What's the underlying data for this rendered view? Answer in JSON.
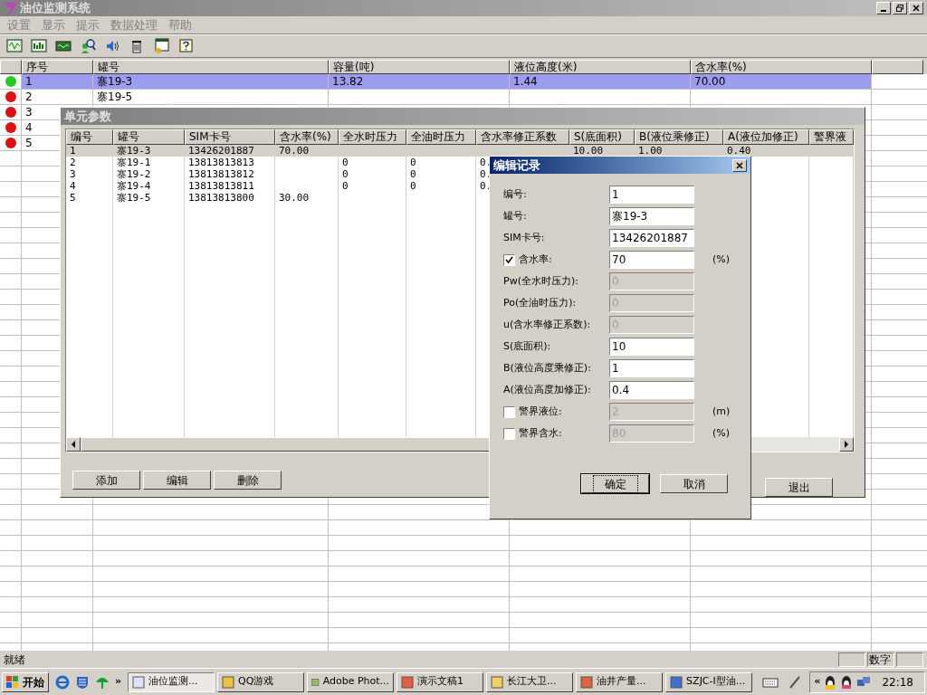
{
  "window": {
    "title": "油位监测系统"
  },
  "menu": [
    "设置",
    "显示",
    "提示",
    "数据处理",
    "帮助"
  ],
  "main_table": {
    "columns": [
      "序号",
      "罐号",
      "容量(吨)",
      "液位高度(米)",
      "含水率(%)"
    ],
    "rows": [
      {
        "color": "#22cc22",
        "selected": true,
        "cells": [
          "1",
          "寨19-3",
          "13.82",
          "1.44",
          "70.00"
        ]
      },
      {
        "color": "#dd1111",
        "selected": false,
        "cells": [
          "2",
          "寨19-5"
        ]
      },
      {
        "color": "#dd1111",
        "selected": false,
        "cells": [
          "3"
        ]
      },
      {
        "color": "#dd1111",
        "selected": false,
        "cells": [
          "4"
        ]
      },
      {
        "color": "#dd1111",
        "selected": false,
        "cells": [
          "5"
        ]
      }
    ]
  },
  "units_dialog": {
    "title": "单元参数",
    "columns": [
      "编号",
      "罐号",
      "SIM卡号",
      "含水率(%)",
      "全水时压力",
      "全油时压力",
      "含水率修正系数",
      "S(底面积)",
      "B(液位乘修正)",
      "A(液位加修正)",
      "警界液"
    ],
    "rows": [
      {
        "selected": true,
        "cells": [
          "1",
          "寨19-3",
          "13426201887",
          "70.00",
          null,
          null,
          null,
          "10.00",
          "1.00",
          "0.40"
        ]
      },
      {
        "selected": false,
        "cells": [
          "2",
          "寨19-1",
          "13813813813",
          null,
          "0",
          "0",
          "0."
        ]
      },
      {
        "selected": false,
        "cells": [
          "3",
          "寨19-2",
          "13813813812",
          null,
          "0",
          "0",
          "0."
        ]
      },
      {
        "selected": false,
        "cells": [
          "4",
          "寨19-4",
          "13813813811",
          null,
          "0",
          "0",
          "0."
        ]
      },
      {
        "selected": false,
        "cells": [
          "5",
          "寨19-5",
          "13813813800",
          "30.00"
        ]
      }
    ],
    "buttons": [
      "添加",
      "编辑",
      "删除"
    ],
    "exit_button": "退出"
  },
  "edit_dialog": {
    "title": "编辑记录",
    "fields": [
      {
        "kind": "text",
        "label": "编号:",
        "value": "1",
        "disabled": false
      },
      {
        "kind": "text",
        "label": "罐号:",
        "value": "寨19-3",
        "disabled": false
      },
      {
        "kind": "text",
        "label": "SIM卡号:",
        "value": "13426201887",
        "disabled": false
      },
      {
        "kind": "check",
        "label": "含水率:",
        "checked": true,
        "value": "70",
        "disabled": false,
        "unit": "(%)"
      },
      {
        "kind": "text",
        "label": "Pw(全水时压力):",
        "value": "0",
        "disabled": true
      },
      {
        "kind": "text",
        "label": "Po(全油时压力):",
        "value": "0",
        "disabled": true
      },
      {
        "kind": "text",
        "label": "u(含水率修正系数):",
        "value": "0",
        "disabled": true
      },
      {
        "kind": "text",
        "label": "S(底面积):",
        "value": "10",
        "disabled": false
      },
      {
        "kind": "text",
        "label": "B(液位高度乘修正):",
        "value": "1",
        "disabled": false
      },
      {
        "kind": "text",
        "label": "A(液位高度加修正):",
        "value": "0.4",
        "disabled": false
      },
      {
        "kind": "check",
        "label": "警界液位:",
        "checked": false,
        "value": "2",
        "disabled": true,
        "unit": "(m)"
      },
      {
        "kind": "check",
        "label": "警界含水:",
        "checked": false,
        "value": "80",
        "disabled": true,
        "unit": "(%)"
      }
    ],
    "buttons": [
      {
        "label": "确定",
        "default": true
      },
      {
        "label": "取消",
        "default": false
      }
    ]
  },
  "status_bar": {
    "text": "就绪",
    "indicator": "数字"
  },
  "taskbar": {
    "start": "开始",
    "more": "»",
    "tasks": [
      {
        "label": "油位监测...",
        "selected": true
      },
      {
        "label": "QQ游戏",
        "selected": false
      },
      {
        "label": "Adobe Phot...",
        "selected": false
      },
      {
        "label": "演示文稿1",
        "selected": false
      },
      {
        "label": "长江大卫...",
        "selected": false
      },
      {
        "label": "油井产量...",
        "selected": false
      },
      {
        "label": "SZJC-I型油...",
        "selected": false
      }
    ],
    "tray_expand": "«",
    "clock": "22:18"
  }
}
